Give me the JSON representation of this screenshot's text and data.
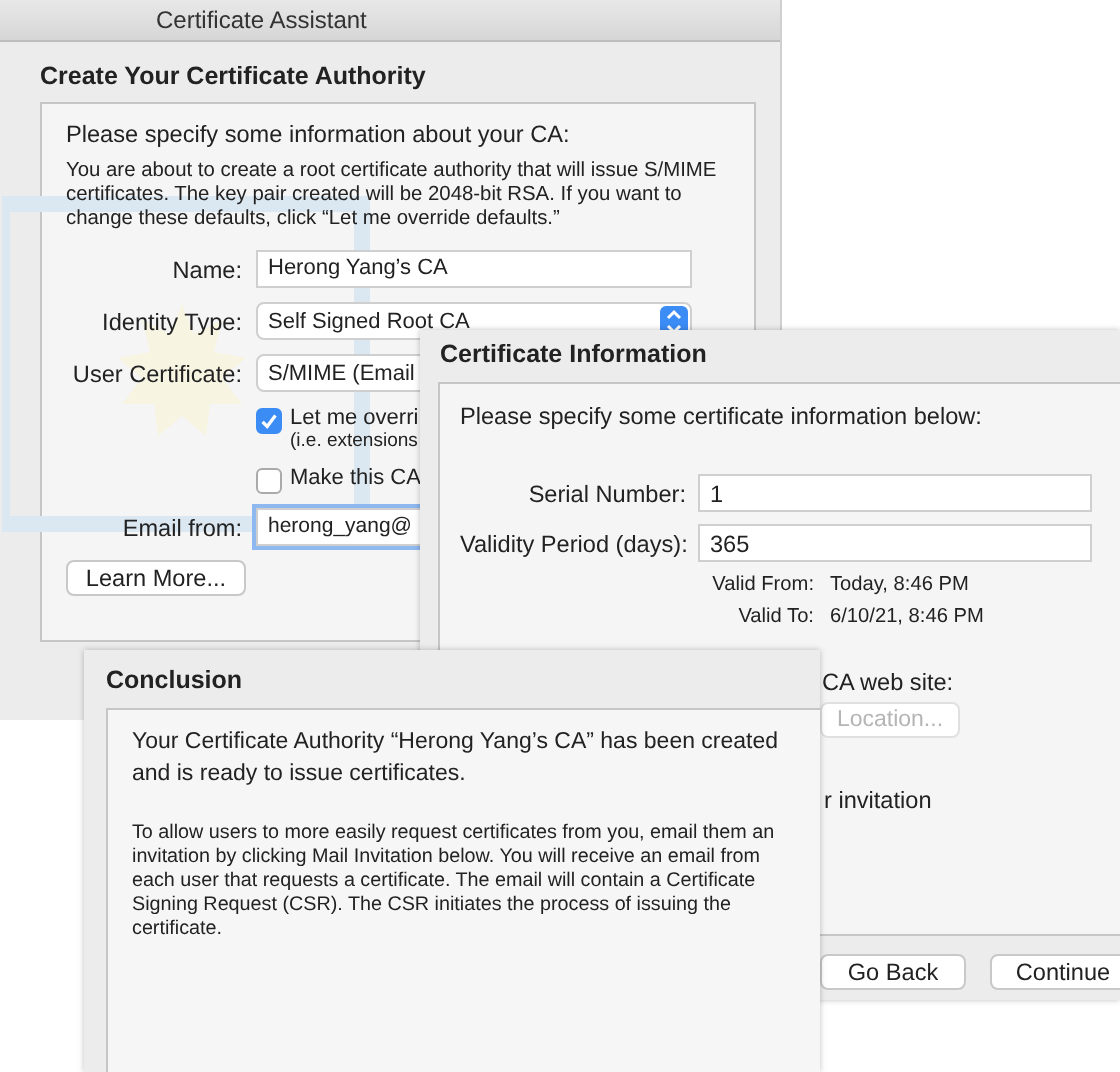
{
  "assistant": {
    "title": "Certificate Assistant",
    "heading": "Create Your Certificate Authority",
    "intro": "Please specify some information about your CA:",
    "note": "You are about to create a root certificate authority that will issue S/MIME certificates. The key pair created will be 2048-bit RSA. If you want to change these defaults, click “Let me override defaults.”",
    "fields": [
      {
        "kind": "text",
        "label": "Name:",
        "value": "Herong Yang’s CA"
      },
      {
        "kind": "popup",
        "label": "Identity Type:",
        "value": "Self Signed Root CA"
      },
      {
        "kind": "covered_popup",
        "label": "User Certificate:",
        "value": "S/MIME (Email"
      }
    ],
    "options": [
      {
        "label": "Let me overri",
        "hint": "(i.e. extensions",
        "checked": true
      },
      {
        "label": "Make this CA",
        "checked": false
      }
    ],
    "email": {
      "label": "Email from:",
      "value": "herong_yang@",
      "focused": true
    },
    "button": "Learn More..."
  },
  "info": {
    "heading": "Certificate Information",
    "intro": "Please specify some certificate information below:",
    "fields": [
      {
        "label": "Serial Number:",
        "value": "1"
      },
      {
        "label": "Validity Period (days):",
        "value": "365"
      }
    ],
    "dates": [
      {
        "label": "Valid From:",
        "value": "Today, 8:46 PM"
      },
      {
        "label": "Valid To:",
        "value": "6/10/21, 8:46 PM"
      }
    ],
    "web_site_label": "CA web site:",
    "location_button": {
      "label": "Location...",
      "disabled": true
    },
    "invitation_text": "r invitation",
    "buttons": [
      "Go Back",
      "Continue"
    ]
  },
  "conclusion": {
    "heading": "Conclusion",
    "message": "Your Certificate Authority “Herong Yang’s CA” has been created and is ready to issue certificates.",
    "details": "To allow users to more easily request certificates from you, email them an invitation by clicking Mail Invitation below. You will receive an email from each user that requests a certificate. The email will contain a Certificate Signing Request (CSR). The CSR initiates the process of issuing the certificate."
  }
}
